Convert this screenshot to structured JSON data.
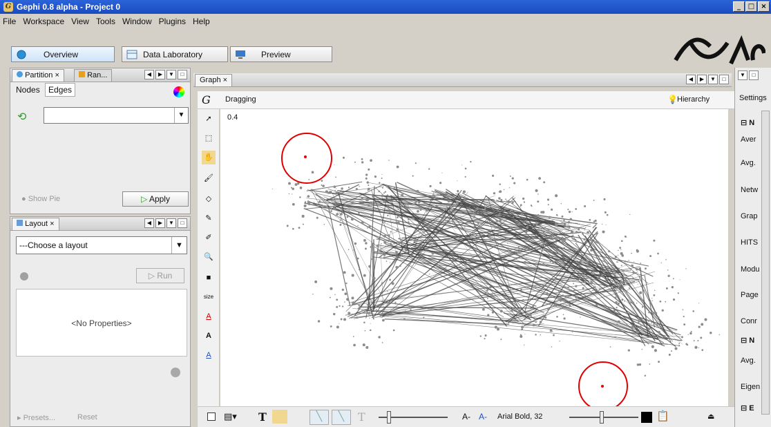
{
  "window": {
    "title": "Gephi 0.8 alpha  - Project 0",
    "min": "_",
    "max": "□",
    "close": "×"
  },
  "menu": [
    "File",
    "Workspace",
    "View",
    "Tools",
    "Window",
    "Plugins",
    "Help"
  ],
  "workspace_tabs": [
    "Overview",
    "Data Laboratory",
    "Preview"
  ],
  "partition": {
    "tabs": [
      "Partition",
      "Ran..."
    ],
    "subtabs": [
      "Nodes",
      "Edges"
    ],
    "show_pie": "Show Pie",
    "apply": "Apply"
  },
  "layout": {
    "tab": "Layout",
    "select": "---Choose a layout",
    "run": "Run",
    "no_properties": "<No Properties>",
    "presets": "Presets...",
    "reset": "Reset"
  },
  "graph": {
    "tab": "Graph",
    "mode": "Dragging",
    "hierarchy": "Hierarchy",
    "scale_label": "0.4",
    "edges": "edges",
    "font_label": "Arial Bold, 32",
    "tools": [
      "pointer-icon",
      "rect-select-icon",
      "drag-icon",
      "brush-icon",
      "diamond-icon",
      "painter-icon",
      "pencil-icon",
      "zoom-icon",
      "square-icon",
      "size",
      "A",
      "A",
      "A"
    ]
  },
  "right_panel": {
    "tab": "Settings",
    "items": [
      "Aver",
      "Avg.",
      "Netw",
      "Grap",
      "HITS",
      "Modu",
      "Page",
      "Conr",
      "Avg.",
      "Eigen"
    ],
    "sections": [
      "N",
      "N",
      "E"
    ]
  },
  "colors": {
    "title": "#1a4bc0",
    "accent_circle": "#e00000",
    "node_gray": "#8c8c8c",
    "edge_dark": "#444444"
  }
}
